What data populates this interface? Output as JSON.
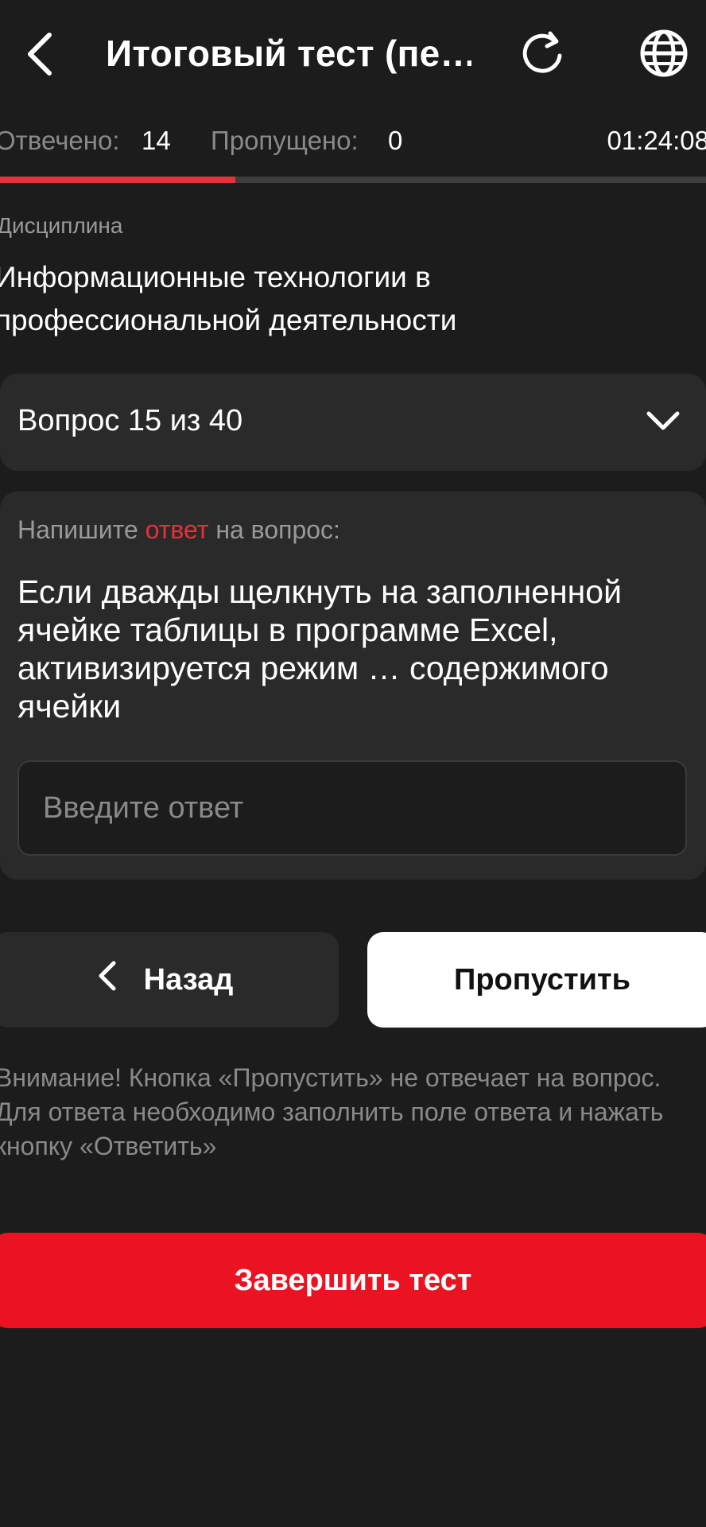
{
  "header": {
    "title": "Итоговый тест (пе…",
    "icons": [
      "chevron-left-icon",
      "refresh-icon",
      "globe-icon"
    ]
  },
  "stats": {
    "answered_label": "Отвечено:",
    "answered_value": "14",
    "skipped_label": "Пропущено:",
    "skipped_value": "0",
    "timer": "01:24:08",
    "progress_fraction": 0.333
  },
  "discipline": {
    "label": "Дисциплина",
    "value": "Информационные технологии в профессиональной деятельности"
  },
  "question_selector": {
    "label": "Вопрос 15 из 40"
  },
  "question": {
    "prompt_before": "Напишите ",
    "prompt_accent": "ответ",
    "prompt_after": " на вопрос:",
    "text": "Если дважды щелкнуть на заполненной ячейке таблицы в программе Excel, активизируется режим … содержимого ячейки",
    "answer_placeholder": "Введите ответ",
    "answer_value": ""
  },
  "buttons": {
    "back": "Назад",
    "skip": "Пропустить",
    "finish": "Завершить тест"
  },
  "warning": "Внимание! Кнопка «Пропустить» не отвечает на вопрос. Для ответа необходимо заполнить поле ответа и нажать кнопку «Ответить»",
  "colors": {
    "background": "#1c1c1c",
    "surface": "#2a2a2a",
    "accent": "#e5323a",
    "finish_button": "#ea1322"
  }
}
